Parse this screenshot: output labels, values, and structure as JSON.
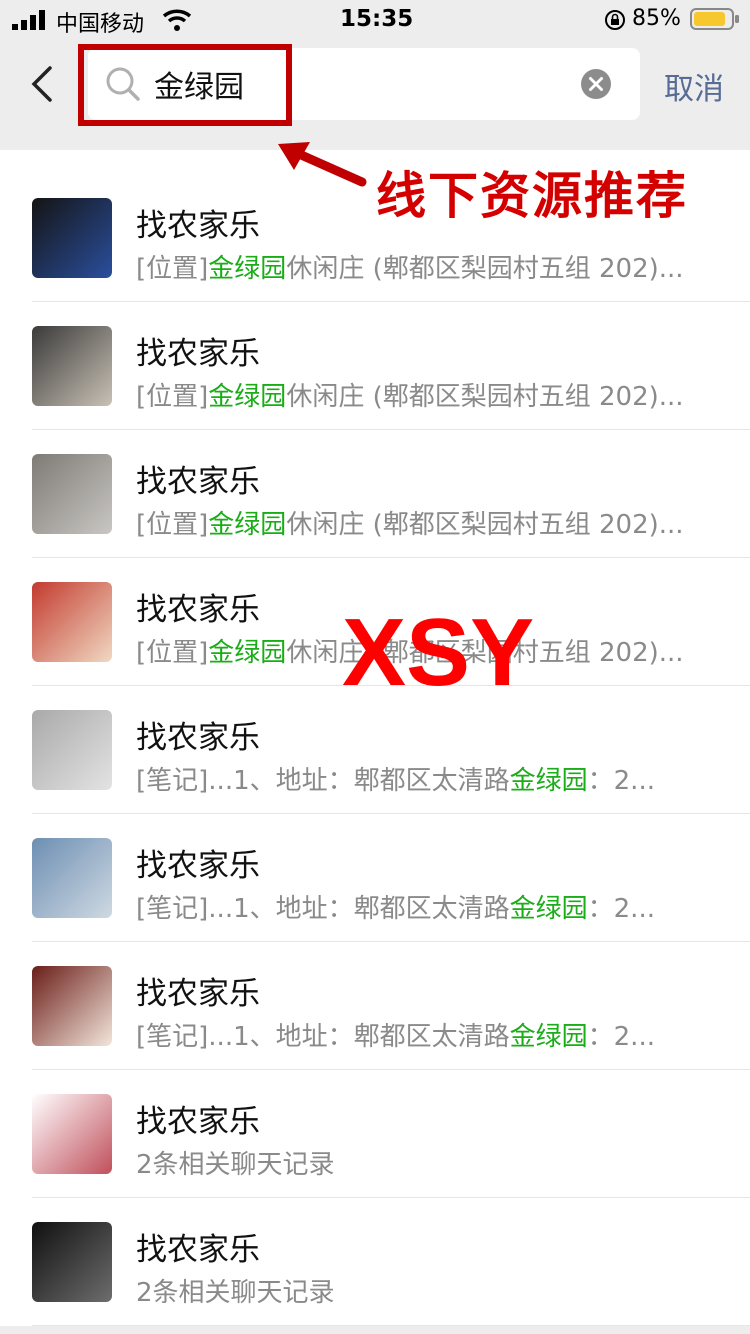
{
  "status": {
    "carrier": "中国移动",
    "time": "15:35",
    "battery": "85%",
    "battery_level": 0.85
  },
  "search": {
    "value": "金绿园",
    "cancel": "取消"
  },
  "annotation": {
    "text": "线下资源推荐",
    "watermark": "XSY",
    "color": "#d40000"
  },
  "list": [
    {
      "title": "找农家乐",
      "prefix": "[位置]",
      "hl": "金绿园",
      "rest": "休闲庄 (郫都区梨园村五组 202)...",
      "avatar_colors": [
        "#141414",
        "#2a4f9e"
      ]
    },
    {
      "title": "找农家乐",
      "prefix": "[位置]",
      "hl": "金绿园",
      "rest": "休闲庄 (郫都区梨园村五组 202)...",
      "avatar_colors": [
        "#3a3a3a",
        "#c9c1b5"
      ]
    },
    {
      "title": "找农家乐",
      "prefix": "[位置]",
      "hl": "金绿园",
      "rest": "休闲庄 (郫都区梨园村五组 202)...",
      "avatar_colors": [
        "#7e7a76",
        "#c9c7c3"
      ]
    },
    {
      "title": "找农家乐",
      "prefix": "[位置]",
      "hl": "金绿园",
      "rest": "休闲庄 (郫都区梨园村五组 202)...",
      "avatar_colors": [
        "#c33a2f",
        "#f0d9c2"
      ]
    },
    {
      "title": "找农家乐",
      "prefix": "[笔记]...1、地址：郫都区太清路",
      "hl": "金绿园",
      "rest": "：2...",
      "avatar_colors": [
        "#a9a9a9",
        "#e3e3e3"
      ]
    },
    {
      "title": "找农家乐",
      "prefix": "[笔记]...1、地址：郫都区太清路",
      "hl": "金绿园",
      "rest": "：2...",
      "avatar_colors": [
        "#6d8fb3",
        "#cfd9e2"
      ]
    },
    {
      "title": "找农家乐",
      "prefix": "[笔记]...1、地址：郫都区太清路",
      "hl": "金绿园",
      "rest": "：2...",
      "avatar_colors": [
        "#6a1d18",
        "#f3e6dc"
      ]
    },
    {
      "title": "找农家乐",
      "prefix": "2条相关聊天记录",
      "hl": "",
      "rest": "",
      "avatar_colors": [
        "#ffffff",
        "#c04f5b"
      ]
    },
    {
      "title": "找农家乐",
      "prefix": "2条相关聊天记录",
      "hl": "",
      "rest": "",
      "avatar_colors": [
        "#101010",
        "#6d6d6d"
      ]
    }
  ]
}
